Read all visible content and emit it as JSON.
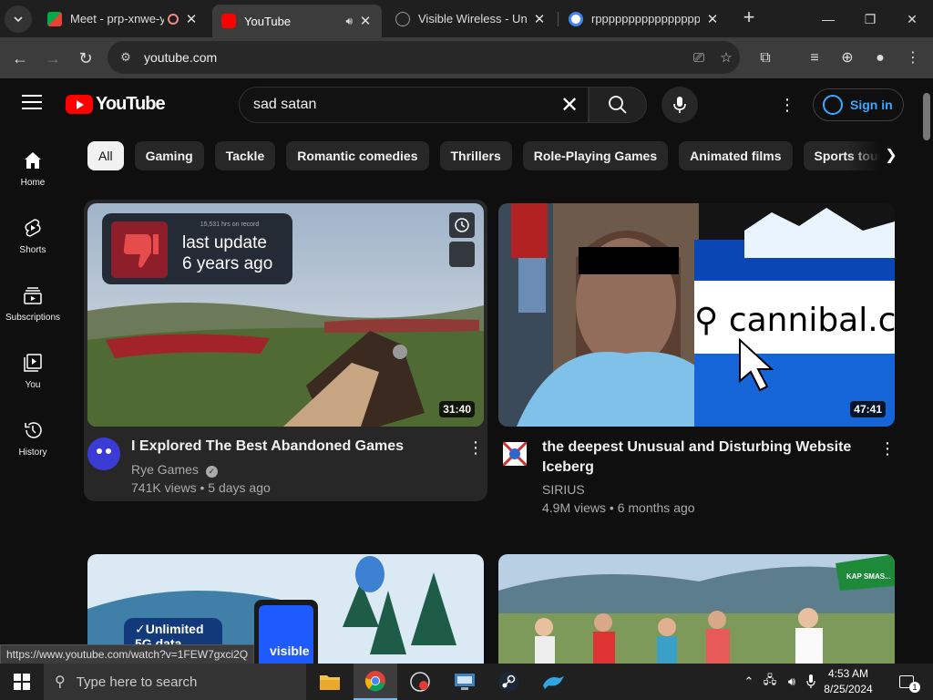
{
  "tabs": [
    {
      "title": "Meet - prp-xnwe-y",
      "favicon_color": "#00ac47"
    },
    {
      "title": "YouTube",
      "favicon_color": "#ff0000"
    },
    {
      "title": "Visible Wireless - Unli",
      "favicon_color": "#333333"
    },
    {
      "title": "rpppppppppppppppp",
      "favicon_color": "#4285f4"
    }
  ],
  "omnibox": {
    "url": "youtube.com"
  },
  "youtube": {
    "logo_text": "YouTube",
    "search": {
      "query": "sad satan"
    },
    "signin_label": "Sign in"
  },
  "sidebar": {
    "items": [
      {
        "label": "Home",
        "icon": "home-icon"
      },
      {
        "label": "Shorts",
        "icon": "shorts-icon"
      },
      {
        "label": "Subscriptions",
        "icon": "subscriptions-icon"
      },
      {
        "label": "You",
        "icon": "you-icon"
      },
      {
        "label": "History",
        "icon": "history-icon"
      }
    ]
  },
  "chips": [
    "All",
    "Gaming",
    "Tackle",
    "Romantic comedies",
    "Thrillers",
    "Role-Playing Games",
    "Animated films",
    "Sports tourn"
  ],
  "videos": [
    {
      "title": "I Explored The Best Abandoned Games",
      "channel": "Rye Games",
      "verified": true,
      "views": "741K views",
      "age": "5 days ago",
      "duration": "31:40",
      "overlay_small": "15,531 hrs on record",
      "overlay_line1": "last update",
      "overlay_line2": "6 years ago"
    },
    {
      "title": "the deepest Unusual and Disturbing Website Iceberg",
      "channel": "SIRIUS",
      "verified": false,
      "views": "4.9M views",
      "age": "6 months ago",
      "duration": "47:41",
      "overlay_text": "cannibal.c"
    },
    {
      "overlay_text": "✓Unlimited 5G data",
      "brand_text": "visible"
    },
    {
      "overlay_text": "KAP SMAS..."
    }
  ],
  "status_url": "https://www.youtube.com/watch?v=1FEW7gxci2Q",
  "taskbar": {
    "search_placeholder": "Type here to search",
    "time": "4:53 AM",
    "date": "8/25/2024",
    "notification_count": "1"
  }
}
